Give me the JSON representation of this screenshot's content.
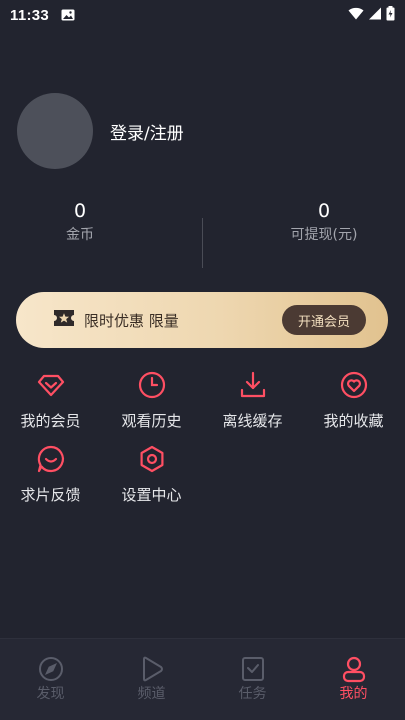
{
  "status_bar": {
    "time": "11:33",
    "icons": [
      "photo-icon",
      "wifi-icon",
      "signal-icon",
      "battery-icon"
    ]
  },
  "profile": {
    "login_label": "登录/注册"
  },
  "stats": {
    "coins": {
      "value": "0",
      "label": "金币"
    },
    "withdrawable": {
      "value": "0",
      "label": "可提现(元)"
    }
  },
  "vip_banner": {
    "text": "限时优惠 限量",
    "button_label": "开通会员",
    "icon": "ticket-star-icon"
  },
  "menu": {
    "items": [
      {
        "label": "我的会员",
        "icon": "diamond-icon"
      },
      {
        "label": "观看历史",
        "icon": "clock-icon"
      },
      {
        "label": "离线缓存",
        "icon": "download-icon"
      },
      {
        "label": "我的收藏",
        "icon": "heart-icon"
      },
      {
        "label": "求片反馈",
        "icon": "feedback-icon"
      },
      {
        "label": "设置中心",
        "icon": "settings-icon"
      }
    ]
  },
  "tabbar": {
    "tabs": [
      {
        "label": "发现",
        "icon": "compass-icon",
        "active": false
      },
      {
        "label": "频道",
        "icon": "play-icon",
        "active": false
      },
      {
        "label": "任务",
        "icon": "task-icon",
        "active": false
      },
      {
        "label": "我的",
        "icon": "user-icon",
        "active": true
      }
    ]
  },
  "colors": {
    "background": "#22242f",
    "accent": "#ff4f63",
    "banner_gold": "#eed7b0",
    "button_brown": "#4b3a33"
  }
}
